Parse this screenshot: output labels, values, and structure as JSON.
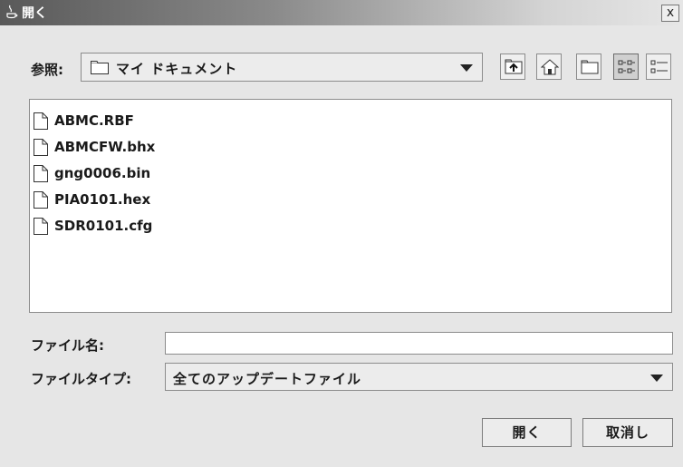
{
  "window": {
    "title": "開く",
    "close_symbol": "x"
  },
  "lookin": {
    "label": "参照:",
    "value": "マイ ドキュメント"
  },
  "toolbar": {
    "buttons": [
      {
        "name": "up-one-level",
        "icon": "up-folder-icon"
      },
      {
        "name": "home",
        "icon": "home-icon"
      },
      {
        "name": "new-folder",
        "icon": "new-folder-icon"
      },
      {
        "name": "list-view",
        "icon": "list-view-icon",
        "pressed": true
      },
      {
        "name": "details-view",
        "icon": "details-view-icon"
      }
    ]
  },
  "files": [
    {
      "name": "ABMC.RBF"
    },
    {
      "name": "ABMCFW.bhx"
    },
    {
      "name": "gng0006.bin"
    },
    {
      "name": "PIA0101.hex"
    },
    {
      "name": "SDR0101.cfg"
    }
  ],
  "filename": {
    "label": "ファイル名:",
    "value": ""
  },
  "filetype": {
    "label": "ファイルタイプ:",
    "value": "全てのアップデートファイル"
  },
  "buttons": {
    "open": "開く",
    "cancel": "取消し"
  }
}
